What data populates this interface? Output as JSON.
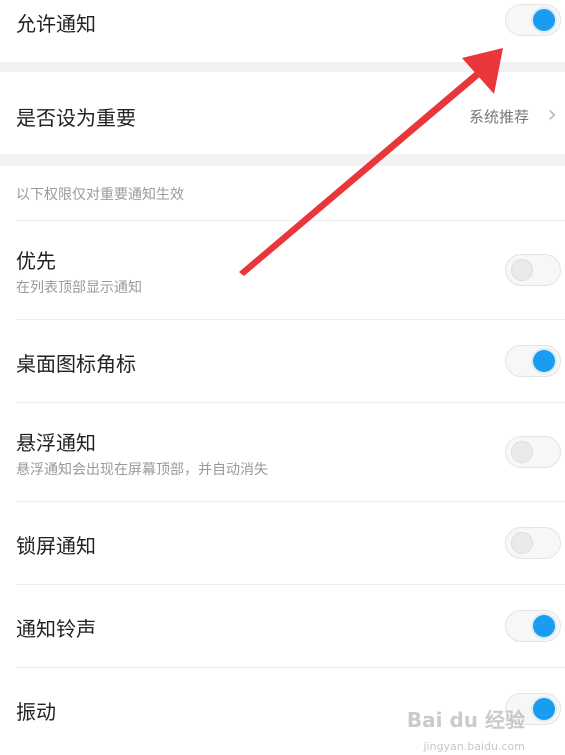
{
  "rows": {
    "allow_notify": {
      "title": "允许通知",
      "toggle": "on"
    },
    "important": {
      "title": "是否设为重要",
      "value": "系统推荐",
      "chevron": "chevron-right-icon"
    },
    "section_note": "以下权限仅对重要通知生效",
    "priority": {
      "title": "优先",
      "subtitle": "在列表顶部显示通知",
      "toggle": "off"
    },
    "badge": {
      "title": "桌面图标角标",
      "toggle": "on"
    },
    "float": {
      "title": "悬浮通知",
      "subtitle": "悬浮通知会出现在屏幕顶部，并自动消失",
      "toggle": "off"
    },
    "lockscreen": {
      "title": "锁屏通知",
      "toggle": "off"
    },
    "ringtone": {
      "title": "通知铃声",
      "toggle": "on"
    },
    "vibrate": {
      "title": "振动",
      "toggle": "on"
    }
  },
  "watermark": {
    "brand": "Bai du 经验",
    "url": "jingyan.baidu.com"
  },
  "colors": {
    "toggle_on": "#1a9cf0",
    "arrow": "#e8363a",
    "section_gap": "#f2f2f2"
  }
}
